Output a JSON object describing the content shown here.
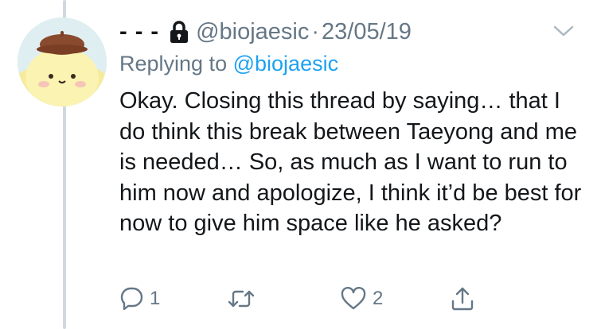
{
  "tweet": {
    "display_name": "- - -",
    "handle": "@biojaesic",
    "separator": "·",
    "date": "23/05/19",
    "replying_prefix": "Replying to",
    "replying_handle": "@biojaesic",
    "text": "Okay. Closing this thread by saying… that I do think this break between Taeyong and me is needed… So, as much as I want to run to him now and apologize, I think it’d be best for now to give him space like he asked?"
  },
  "actions": {
    "reply": {
      "icon": "reply-icon",
      "count": "1"
    },
    "retweet": {
      "icon": "retweet-icon",
      "count": ""
    },
    "like": {
      "icon": "heart-icon",
      "count": "2"
    },
    "share": {
      "icon": "share-icon"
    }
  },
  "icons": {
    "protected": "lock-icon",
    "menu": "chevron-down-icon"
  },
  "colors": {
    "text": "#14171a",
    "secondary": "#657786",
    "link": "#1da1f2",
    "thread_line": "#cfd9de"
  }
}
